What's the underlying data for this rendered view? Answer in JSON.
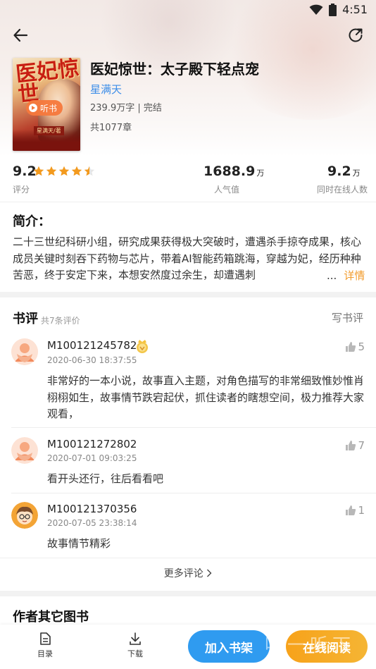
{
  "status": {
    "time": "4:51"
  },
  "book": {
    "title": "医妃惊世：太子殿下轻点宠",
    "author": "星满天",
    "meta": "239.9万字 | 完结",
    "chapters": "共1077章",
    "listen_label": "听书",
    "cover_text": "医妃惊世",
    "cover_author": "星满天/著"
  },
  "stats": {
    "rating": "9.2",
    "rating_label": "评分",
    "rating_stars": 4.5,
    "popularity": "1688.9",
    "popularity_unit": "万",
    "popularity_label": "人气值",
    "online": "9.2",
    "online_unit": "万",
    "online_label": "同时在线人数"
  },
  "intro": {
    "heading": "简介：",
    "text": "二十三世纪科研小组，研究成果获得极大突破时，遭遇杀手掠夺成果，核心成员关键时刻吞下药物与芯片，带着AI智能药箱跳海，穿越为妃，经历种种苦恶，终于安定下来，本想安然度过余生，却遭遇刺",
    "ellipsis": "...",
    "more_label": "详情"
  },
  "reviews": {
    "heading": "书评",
    "count": "共7条评价",
    "write_label": "写书评",
    "items": [
      {
        "user": "M100121245782",
        "time": "2020-06-30 18:37:55",
        "likes": "5",
        "text": "非常好的一本小说，故事直入主题，对角色描写的非常细致惟妙惟肖栩栩如生，故事情节跌宕起伏，抓住读者的瞎想空间，极力推荐大家观看，",
        "vip": true
      },
      {
        "user": "M100121272802",
        "time": "2020-07-01 09:03:25",
        "likes": "7",
        "text": "看开头还行，往后看看吧",
        "vip": false
      },
      {
        "user": "M100121370356",
        "time": "2020-07-05 23:38:14",
        "likes": "1",
        "text": "故事情节精彩",
        "vip": false
      }
    ],
    "more_label": "更多评论"
  },
  "other_books": {
    "heading": "作者其它图书"
  },
  "bottom_bar": {
    "catalog_label": "目录",
    "download_label": "下载",
    "add_shelf_label": "加入书架",
    "read_online_label": "在线阅读"
  },
  "watermark": "听一听下载",
  "colors": {
    "accent_blue": "#2f9bf0",
    "accent_orange": "#f7a21a",
    "star": "#f39a1e",
    "author_link": "#3d8ee8"
  }
}
